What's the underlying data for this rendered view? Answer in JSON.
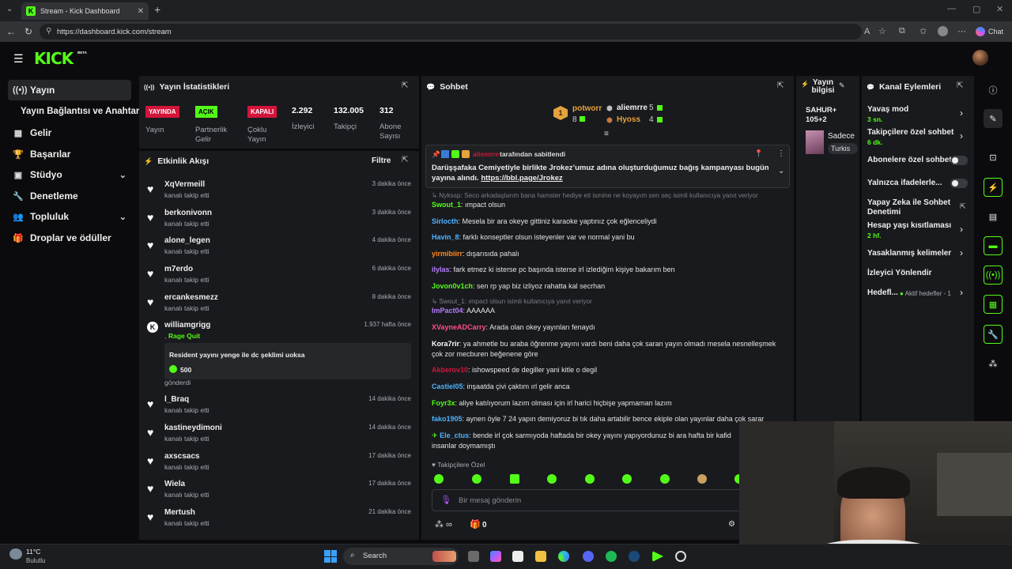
{
  "browser": {
    "tab_title": "Stream - Kick Dashboard",
    "url": "https://dashboard.kick.com/stream",
    "chat_button": "Chat"
  },
  "header": {
    "logo": "KICK",
    "beta": "BETA"
  },
  "sidebar": {
    "items": [
      {
        "label": "Yayın",
        "icon": "broadcast-icon"
      },
      {
        "label": "Yayın Bağlantısı ve Anahtarı",
        "icon": ""
      },
      {
        "label": "Gelir",
        "icon": "revenue-icon"
      },
      {
        "label": "Başarılar",
        "icon": "trophy-icon"
      },
      {
        "label": "Stüdyo",
        "icon": "studio-icon"
      },
      {
        "label": "Denetleme",
        "icon": "wrench-icon"
      },
      {
        "label": "Topluluk",
        "icon": "community-icon"
      },
      {
        "label": "Droplar ve ödüller",
        "icon": "gift-icon"
      }
    ]
  },
  "stats": {
    "title": "Yayın İstatistikleri",
    "badges": [
      {
        "text": "YAYINDA",
        "label": "Yayın",
        "color": "#d4143a"
      },
      {
        "text": "AÇIK",
        "label": "Partnerlik Gelir",
        "color": "#53fc18"
      },
      {
        "text": "KAPALI",
        "label": "Çoklu Yayın",
        "color": "#d4143a"
      }
    ],
    "numbers": [
      {
        "value": "2.292",
        "label": "İzleyici"
      },
      {
        "value": "132.005",
        "label": "Takipçi"
      },
      {
        "value": "312",
        "label": "Abone Sayısı"
      }
    ]
  },
  "activity": {
    "title": "Etkinlik Akışı",
    "filter": "Filtre",
    "rows": [
      {
        "name": "XqVermeill",
        "sub": "kanalı takip etti",
        "time": "3 dakika önce"
      },
      {
        "name": "berkonivonn",
        "sub": "kanalı takip etti",
        "time": "3 dakika önce"
      },
      {
        "name": "alone_legen",
        "sub": "kanalı takip etti",
        "time": "4 dakika önce"
      },
      {
        "name": "m7erdo",
        "sub": "kanalı takip etti",
        "time": "6 dakika önce"
      },
      {
        "name": "ercankesmezz",
        "sub": "kanalı takip etti",
        "time": "8 dakika önce"
      }
    ],
    "gift": {
      "name": "williamgrigg",
      "time": "1.937 hafta önce",
      "prefix": ",",
      "tag": "Rage Quit",
      "message": "Resident yayını yenge ile dc şeklimi uoksa",
      "amount": "500",
      "sent": "gönderdi"
    },
    "rows2": [
      {
        "name": "l_Braq",
        "sub": "kanalı takip etti",
        "time": "14 dakika önce"
      },
      {
        "name": "kastineydimoni",
        "sub": "kanalı takip etti",
        "time": "14 dakika önce"
      },
      {
        "name": "axscsacs",
        "sub": "kanalı takip etti",
        "time": "17 dakika önce"
      },
      {
        "name": "Wiela",
        "sub": "kanalı takip etti",
        "time": "17 dakika önce"
      },
      {
        "name": "Mertush",
        "sub": "kanalı takip etti",
        "time": "21 dakika önce"
      }
    ]
  },
  "chat": {
    "title": "Sohbet",
    "leaderboard": [
      {
        "rank": "1",
        "name": "potworr",
        "value": "8"
      },
      {
        "name": "aliemrre",
        "value": "5"
      },
      {
        "name": "Hyoss",
        "value": "4"
      }
    ],
    "pinned": {
      "by": "aliemrre",
      "by_suffix": "tarafından sabitlendi",
      "text": "Darüşşafaka Cemiyetiyle birlikte Jrokez’umuz adına oluşturduğumuz bağış kampanyası bugün yayına alındı.",
      "link": "https://bbl.page/Jrokez"
    },
    "messages": [
      {
        "type": "reply",
        "text": "Nykssp: Seco arkadaşlarım bana hamster hediye eti ismine ne koyayım sen seç isimli kullanıcıya yanıt veriyor"
      },
      {
        "user": "Swout_1",
        "color": "#53fc18",
        "text": "ımpact olsun"
      },
      {
        "user": "Sirlocth",
        "color": "#4fb3ff",
        "text": "Mesela bir ara okeye gittiniz karaoke yaptınız çok eğlenceliydi"
      },
      {
        "user": "Havin_8",
        "color": "#4fb3ff",
        "text": "farklı konseptler olsun isteyenler var ve normal yani bu"
      },
      {
        "user": "yirmibiirr",
        "color": "#ff8a1f",
        "text": "dışarısıda pahalı"
      },
      {
        "user": "ilylas",
        "color": "#b67cff",
        "text": "fark etmez ki isterse pc başında isterse irl izlediğim kişiye bakarım ben"
      },
      {
        "user": "Jovon0v1ch",
        "color": "#53fc18",
        "text": "sen rp yap biz izliyoz rahatta kal secrhan"
      },
      {
        "type": "reply",
        "text": "Swout_1: ımpact olsun isimli kullanıcıya yanıt veriyor"
      },
      {
        "user": "ImPact04",
        "color": "#b67cff",
        "text": "AAAAAA"
      },
      {
        "user": "XVayneADCarry",
        "color": "#ff4d8d",
        "text": "Arada olan okey yayınları fenaydı"
      },
      {
        "user": "Kora7rir",
        "color": "#ffffff",
        "text": "ya ahmetle bu araba öğrenme yayını vardı beni daha çok saran yayın olmadı mesela nesnelleşmek çok zor mecburen beğenene göre"
      },
      {
        "user": "Akberov10",
        "color": "#d4143a",
        "text": "ishowspeed de degiller yani kitle o degil"
      },
      {
        "user": "Castiel05",
        "color": "#4fb3ff",
        "text": "inşaatda çivi çaktım ırl gelir anca"
      },
      {
        "user": "Foyr3x",
        "color": "#53fc18",
        "text": "aliye katılıyorum lazım olması için irl harici hiçbişe yapmaman lazım"
      },
      {
        "user": "fako1905",
        "color": "#4fb3ff",
        "text": "aynen öyle 7 24 yapın demiyoruz bi tık daha artabilir bence ekiple olan yayınlar daha çok sarar"
      },
      {
        "user": "Ele_ctus",
        "color": "#4fb3ff",
        "text": "bende irl çok sarmıyoda haftada bir okey yayını yapıyordunuz bi ara hafta bir kafid insanlar doymamıştı"
      }
    ],
    "followers_only": "Takipçilere Özel",
    "placeholder": "Bir mesaj gönderin",
    "bottom_count": "0"
  },
  "stream_info": {
    "title": "Yayın bilgisi",
    "stream_title": "SAHUR+ 105+2",
    "category_line": "Sadece",
    "tag": "Turkis"
  },
  "actions": {
    "title": "Kanal Eylemleri",
    "items": [
      {
        "label": "Yavaş mod",
        "sub": "3 sn."
      },
      {
        "label": "Takipçilere özel sohbet",
        "sub": "6 dk."
      },
      {
        "label": "Abonelere özel sohbet",
        "sub": ""
      },
      {
        "label": "Yalnızca ifadelerle...",
        "sub": ""
      },
      {
        "label": "Yapay Zeka ile Sohbet Denetimi",
        "sub": ""
      },
      {
        "label": "Hesap yaşı kısıtlaması",
        "sub": "2 hf."
      },
      {
        "label": "Yasaklanmış kelimeler",
        "sub": ""
      },
      {
        "label": "İzleyici Yönlendir",
        "sub": ""
      },
      {
        "label": "Hedefl...",
        "sub": "Aktif hedefler - 1"
      }
    ]
  },
  "taskbar": {
    "temp": "11°C",
    "weather": "Bulutlu",
    "search": "Search"
  },
  "colors": {
    "accent": "#53fc18",
    "danger": "#d4143a",
    "panel": "#191a1d"
  }
}
